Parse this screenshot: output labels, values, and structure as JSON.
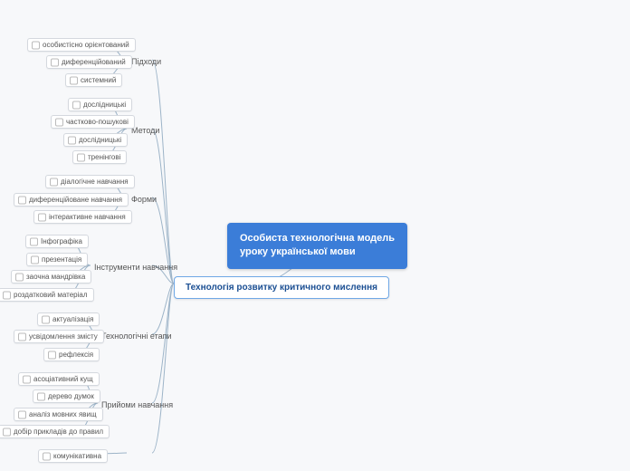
{
  "root": {
    "line1": "Особиста технологічна модель",
    "line2": "уроку української мови"
  },
  "main": "Технологія розвитку критичного мислення",
  "cats": {
    "approaches": "Підходи",
    "methods": "Методи",
    "forms": "Форми",
    "tools": "Інструменти навчання",
    "stages": "Технологічні етапи",
    "techniques": "Прийоми навчання"
  },
  "approaches": [
    "особистісно орієнтований",
    "диференційований",
    "системний"
  ],
  "methods": [
    "дослідницькі",
    "частково-пошукові",
    "дослідницькі",
    "тренінгові"
  ],
  "forms": [
    "діалогічне навчання",
    "диференційоване навчання",
    "інтерактивне навчання"
  ],
  "tools": [
    "Інфографіка",
    "презентація",
    "заочна мандрівка",
    "роздатковий матеріал"
  ],
  "stages": [
    "актуалізація",
    "усвідомлення змісту",
    "рефлексія"
  ],
  "techniques": [
    "асоціативний кущ",
    "дерево думок",
    "аналіз мовних явищ",
    "добір прикладів до правил"
  ],
  "extra": [
    "комунікативна"
  ]
}
